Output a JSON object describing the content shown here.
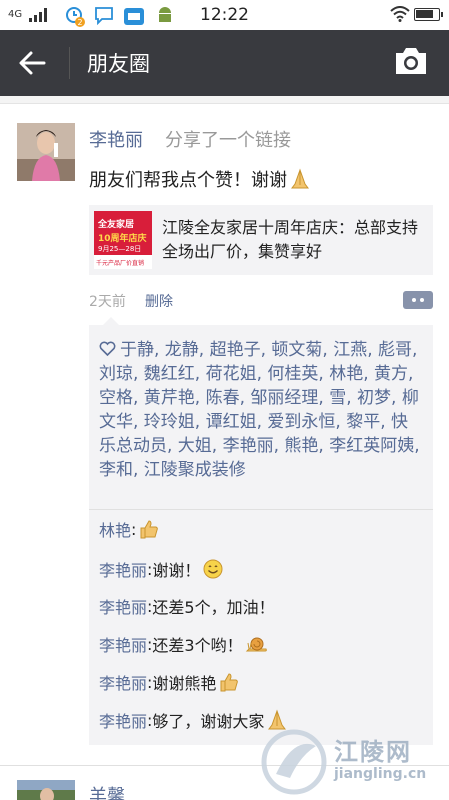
{
  "status_bar": {
    "network": "4G",
    "time": "12:22",
    "notif_badge": "2"
  },
  "header": {
    "title": "朋友圈",
    "back_icon": "arrow-left-icon",
    "camera_icon": "camera-icon"
  },
  "post": {
    "author": "李艳丽",
    "shared_text": "分享了一个链接",
    "text": "朋友们帮我点个赞！谢谢",
    "link": {
      "title": "江陵全友家居十周年店庆：总部支持全场出厂价，集赞享好",
      "thumb_brand": "全友家居",
      "thumb_line1": "10周年店庆",
      "thumb_line2": "9月25—28日",
      "thumb_line3": "千元产品厂价直销"
    },
    "time_ago": "2天前",
    "delete_label": "删除",
    "likes": "于静, 龙静, 超艳子, 顿文菊, 江燕, 彪哥, 刘琼, 魏红红, 荷花姐, 何桂英, 林艳, 黄方, 空格, 黄芹艳, 陈春, 邹丽经理, 雪, 初梦, 柳文华, 玲玲姐, 谭红姐, 爱到永恒, 黎平, 快乐总动员, 大姐, 李艳丽, 熊艳, 李红英阿姨, 李和, 江陵聚成装修",
    "comments": [
      {
        "who": "林艳",
        "text": "",
        "emoji": "thumbs-up"
      },
      {
        "who": "李艳丽",
        "text": "谢谢！",
        "emoji": "smile"
      },
      {
        "who": "李艳丽",
        "text": "还差5个，加油！",
        "emoji": ""
      },
      {
        "who": "李艳丽",
        "text": "还差3个哟！",
        "emoji": "snail"
      },
      {
        "who": "李艳丽",
        "text": "谢谢熊艳",
        "emoji": "thumbs-up"
      },
      {
        "who": "李艳丽",
        "text": "够了，谢谢大家",
        "emoji": "pray"
      }
    ]
  },
  "next_post": {
    "author": "羊馨"
  },
  "watermark": {
    "name": "江陵网",
    "url": "jiangling.cn"
  },
  "colors": {
    "header_bg": "#393a3f",
    "name_blue": "#576b95",
    "comment_bg": "#f3f3f5"
  }
}
